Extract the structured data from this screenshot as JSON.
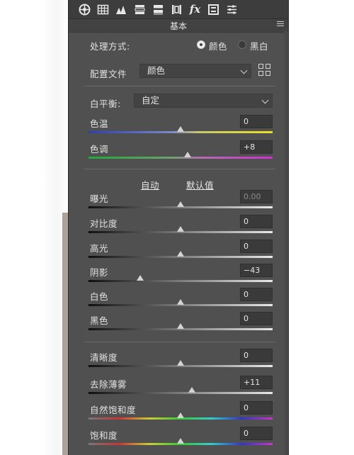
{
  "toolbar": {
    "fx_label": "fx"
  },
  "panel": {
    "title": "基本"
  },
  "treatment": {
    "label": "处理方式:",
    "option_color": "颜色",
    "option_bw": "黑白",
    "selected": "颜色"
  },
  "profile": {
    "label": "配置文件",
    "value": "颜色"
  },
  "white_balance": {
    "label": "白平衡:",
    "value": "自定"
  },
  "wb_sliders": [
    {
      "label": "色温",
      "value": "0",
      "level": 0.5
    },
    {
      "label": "色调",
      "value": "+8",
      "level": 0.54
    }
  ],
  "auto_default": {
    "auto": "自动",
    "default": "默认值"
  },
  "tone_sliders": [
    {
      "label": "曝光",
      "value": "0.00",
      "level": 0.5,
      "dim": true
    },
    {
      "label": "对比度",
      "value": "0",
      "level": 0.5
    },
    {
      "label": "高光",
      "value": "0",
      "level": 0.5
    },
    {
      "label": "阴影",
      "value": "−43",
      "level": 0.28
    },
    {
      "label": "白色",
      "value": "0",
      "level": 0.5
    },
    {
      "label": "黑色",
      "value": "0",
      "level": 0.5
    }
  ],
  "presence_sliders": [
    {
      "label": "清晰度",
      "value": "0",
      "level": 0.5
    },
    {
      "label": "去除薄雾",
      "value": "+11",
      "level": 0.56
    },
    {
      "label": "自然饱和度",
      "value": "0",
      "level": 0.5
    },
    {
      "label": "饱和度",
      "value": "0",
      "level": 0.5
    }
  ],
  "colors": {
    "panel_bg": "#505050",
    "temp_track": "linear-gradient(90deg,#2b3fb8,#7a8ac8 45%,#c8c86a 60%,#e8e020)",
    "tint_track": "linear-gradient(90deg,#1faa3a,#70a070 45%,#b070b0 60%,#d02fd0)",
    "tone_track": "linear-gradient(90deg,#101010,#e8e8e8)",
    "sat_track": "linear-gradient(90deg,#777,#c33,#cc3,#3c3,#3cc,#33c,#c3c)"
  }
}
